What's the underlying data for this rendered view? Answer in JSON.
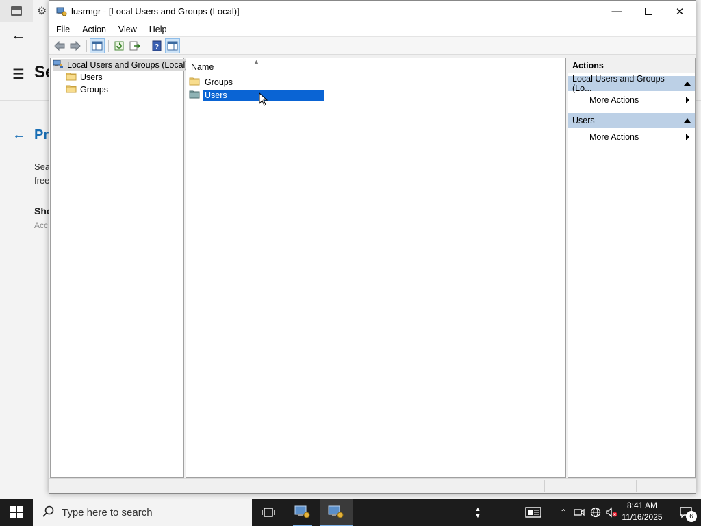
{
  "background_app": {
    "title_partial": "Se",
    "heading_partial": "Pr",
    "line1_partial": "Sea",
    "line2_partial": "free",
    "line3_partial": "Sho",
    "line4_partial": "Acc"
  },
  "window": {
    "title": "lusrmgr - [Local Users and Groups (Local)]",
    "minimize_glyph": "—",
    "close_glyph": "✕"
  },
  "menubar": {
    "items": [
      "File",
      "Action",
      "View",
      "Help"
    ]
  },
  "tree": {
    "root": "Local Users and Groups (Local)",
    "children": [
      "Users",
      "Groups"
    ]
  },
  "list": {
    "column_name": "Name",
    "rows": [
      {
        "label": "Groups",
        "selected": false
      },
      {
        "label": "Users",
        "selected": true
      }
    ]
  },
  "actions": {
    "header": "Actions",
    "sections": [
      {
        "title": "Local Users and Groups (Lo...",
        "item": "More Actions"
      },
      {
        "title": "Users",
        "item": "More Actions"
      }
    ]
  },
  "taskbar": {
    "search_placeholder": "Type here to search",
    "time": "8:41 AM",
    "date": "11/16/2025",
    "notification_count": "6"
  },
  "colors": {
    "selection": "#0a64d4",
    "action_section": "#bcd0e6",
    "taskbar": "#1c1c1c"
  }
}
